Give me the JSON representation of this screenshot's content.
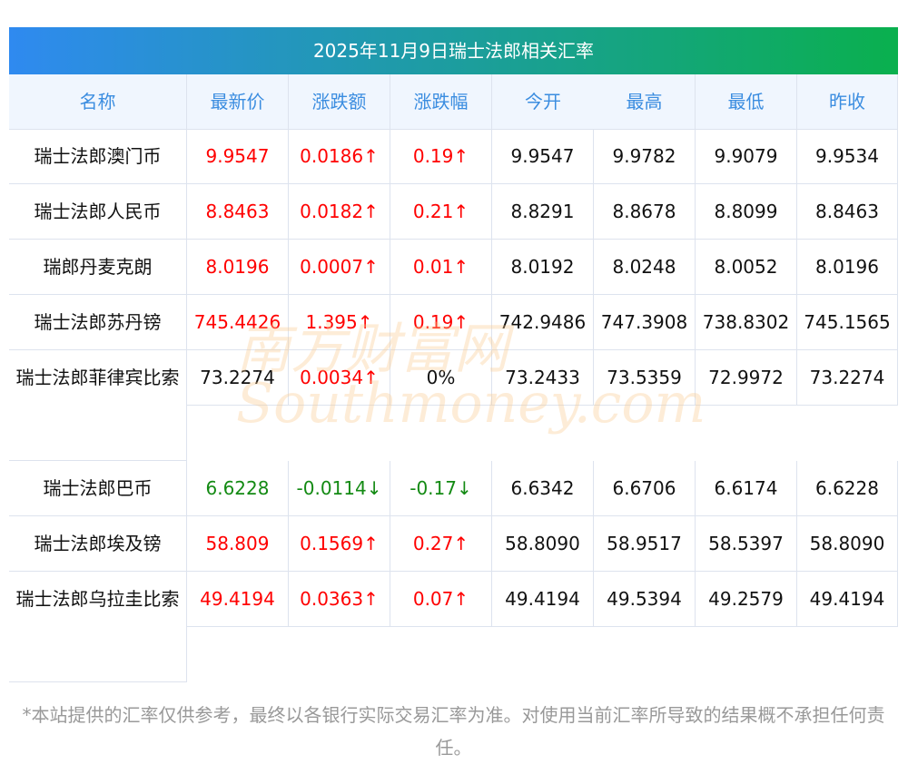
{
  "title": "2025年11月9日瑞士法郎相关汇率",
  "headers": [
    "名称",
    "最新价",
    "涨跌额",
    "涨跌幅",
    "今开",
    "最高",
    "最低",
    "昨收"
  ],
  "rows": [
    {
      "name": "瑞士法郎澳门币",
      "dir": "up",
      "latest": "9.9547",
      "change": "0.0186↑",
      "pct": "0.19↑",
      "open": "9.9547",
      "high": "9.9782",
      "low": "9.9079",
      "prev": "9.9534"
    },
    {
      "name": "瑞士法郎人民币",
      "dir": "up",
      "latest": "8.8463",
      "change": "0.0182↑",
      "pct": "0.21↑",
      "open": "8.8291",
      "high": "8.8678",
      "low": "8.8099",
      "prev": "8.8463"
    },
    {
      "name": "瑞郎丹麦克朗",
      "dir": "up",
      "latest": "8.0196",
      "change": "0.0007↑",
      "pct": "0.01↑",
      "open": "8.0192",
      "high": "8.0248",
      "low": "8.0052",
      "prev": "8.0196"
    },
    {
      "name": "瑞士法郎苏丹镑",
      "dir": "up",
      "latest": "745.4426",
      "change": "1.395↑",
      "pct": "0.19↑",
      "open": "742.9486",
      "high": "747.3908",
      "low": "738.8302",
      "prev": "745.1565"
    },
    {
      "name": "瑞士法郎菲律宾比索",
      "dir": "flat",
      "latest": "73.2274",
      "change": "0.0034↑",
      "pct": "0%",
      "open": "73.2433",
      "high": "73.5359",
      "low": "72.9972",
      "prev": "73.2274"
    },
    {
      "name": "瑞士法郎巴币",
      "dir": "down",
      "latest": "6.6228",
      "change": "-0.0114↓",
      "pct": "-0.17↓",
      "open": "6.6342",
      "high": "6.6706",
      "low": "6.6174",
      "prev": "6.6228"
    },
    {
      "name": "瑞士法郎埃及镑",
      "dir": "up",
      "latest": "58.809",
      "change": "0.1569↑",
      "pct": "0.27↑",
      "open": "58.8090",
      "high": "58.9517",
      "low": "58.5397",
      "prev": "58.8090"
    },
    {
      "name": "瑞士法郎乌拉圭比索",
      "dir": "up",
      "latest": "49.4194",
      "change": "0.0363↑",
      "pct": "0.07↑",
      "open": "49.4194",
      "high": "49.5394",
      "low": "49.2579",
      "prev": "49.4194"
    }
  ],
  "watermark": "南方财富网 Southmoney.com",
  "footer": "*本站提供的汇率仅供参考，最终以各银行实际交易汇率为准。对使用当前汇率所导致的结果概不承担任何责任。",
  "colors": {
    "up": "#ff0000",
    "down": "#138a13",
    "header_text": "#3b8de0"
  }
}
